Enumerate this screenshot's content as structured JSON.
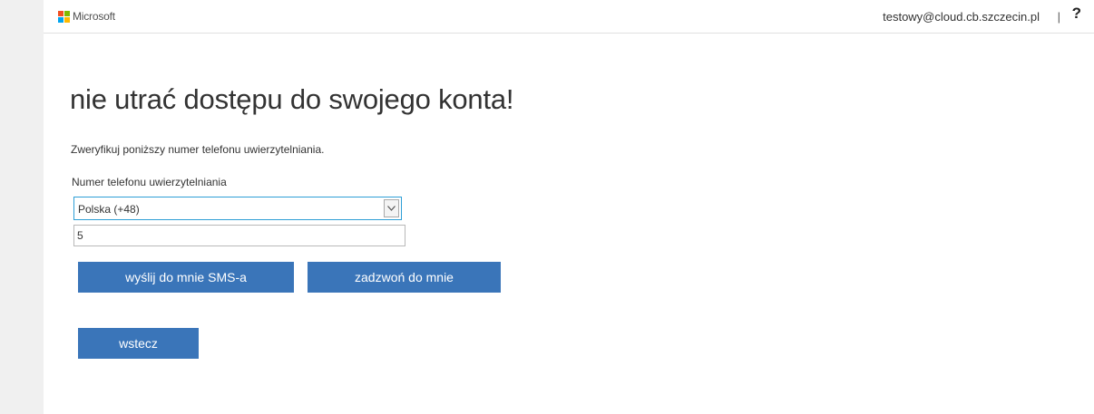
{
  "header": {
    "brand": "Microsoft",
    "user_email": "testowy@cloud.cb.szczecin.pl",
    "separator": "|",
    "help_label": "?"
  },
  "main": {
    "title": "nie utrać dostępu do swojego konta!",
    "description": "Zweryfikuj poniższy numer telefonu uwierzytelniania.",
    "phone_label": "Numer telefonu uwierzytelniania",
    "country_select": {
      "selected": "Polska (+48)"
    },
    "phone_input": {
      "value": "5"
    },
    "sms_button": "wyślij do mnie SMS-a",
    "call_button": "zadzwoń do mnie",
    "back_button": "wstecz"
  },
  "colors": {
    "accent": "#3a75b9",
    "focus_border": "#2e9fd6",
    "logo_red": "#f25022",
    "logo_green": "#7fba00",
    "logo_blue": "#00a4ef",
    "logo_yellow": "#ffb900"
  },
  "icons": {
    "logo": "microsoft-logo-icon",
    "select_arrow": "chevron-down-icon"
  }
}
